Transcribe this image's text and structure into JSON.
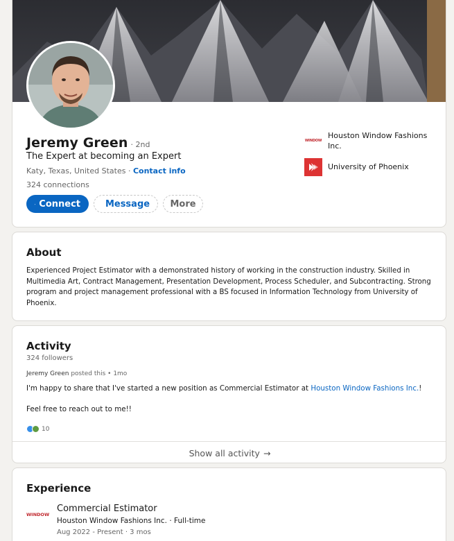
{
  "profile": {
    "name": "Jeremy Green",
    "degree": "· 2nd",
    "headline": "The Expert at becoming an Expert",
    "location": "Katy, Texas, United States · ",
    "contact_info": "Contact info",
    "connections": "324 connections",
    "buttons": {
      "connect": "Connect",
      "message": "Message",
      "more": "More"
    },
    "affiliations": [
      {
        "name": "Houston Window Fashions Inc.",
        "logo_text": "WINDOW",
        "icon": "company-logo"
      },
      {
        "name": "University of Phoenix",
        "icon": "university-logo"
      }
    ]
  },
  "about": {
    "title": "About",
    "text": "Experienced Project Estimator with a demonstrated history of working in the construction industry. Skilled in Multimedia Art, Contract Management, Presentation Development, Process Scheduler, and Subcontracting. Strong program and project management professional with a BS focused in Information Technology from University of Phoenix."
  },
  "activity": {
    "title": "Activity",
    "followers": "324 followers",
    "post_author": "Jeremy Green",
    "post_meta": " posted this • 1mo",
    "post_text_prefix": "I'm happy to share that I've started a new position as Commercial Estimator at ",
    "post_link": "Houston Window Fashions Inc.",
    "post_text_suffix": "!",
    "post_text_line2": "Feel free to reach out to me!!",
    "reaction_count": "10",
    "show_all": "Show all activity",
    "show_all_arrow": "→"
  },
  "experience": {
    "title": "Experience",
    "items": [
      {
        "logo_text": "WINDOW",
        "role": "Commercial Estimator",
        "company": "Houston Window Fashions Inc. · Full-time",
        "dates": "Aug 2022 - Present · 3 mos"
      }
    ]
  },
  "colors": {
    "primary": "#0a66c2",
    "background": "#f3f2ef",
    "uop_red": "#dd3333",
    "window_red": "#c0272d"
  }
}
